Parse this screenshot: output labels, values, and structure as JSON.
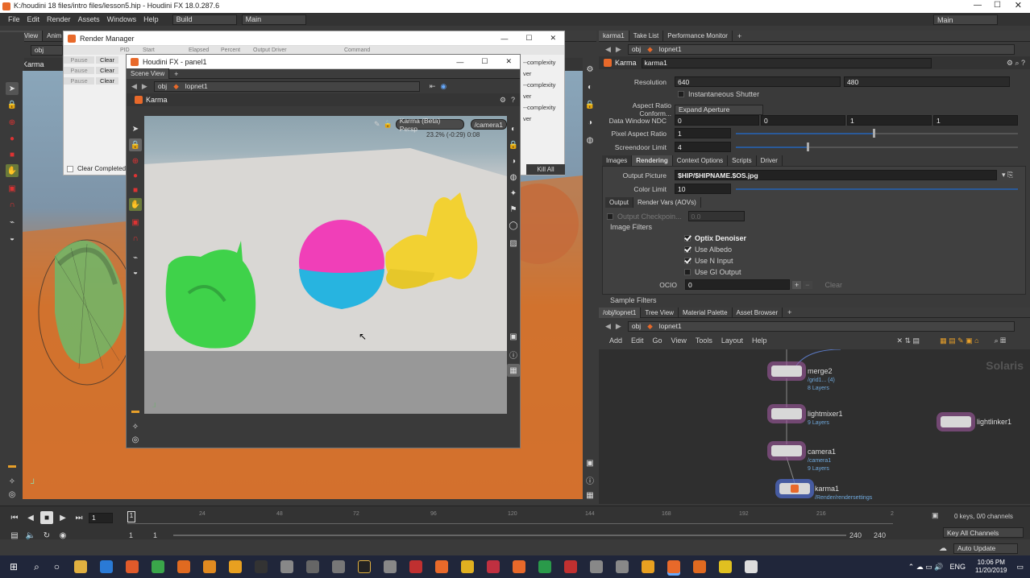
{
  "window": {
    "title": "K:/houdini 18 files/intro files/lesson5.hip - Houdini FX 18.0.287.6"
  },
  "menu": {
    "items": [
      "File",
      "Edit",
      "Render",
      "Assets",
      "Windows",
      "Help"
    ],
    "desktop": "Build",
    "desk_main": "Main",
    "right_main": "Main"
  },
  "left_pane": {
    "tabs": [
      "Scene View",
      "Anim"
    ],
    "path": "obj",
    "renderer": "Karma"
  },
  "render_manager": {
    "title": "Render Manager",
    "columns": [
      "PID",
      "Start",
      "Elapsed",
      "Percent",
      "Output Driver",
      "Command"
    ],
    "rows": [
      {
        "a": "Pause",
        "b": "Clear"
      },
      {
        "a": "Pause",
        "b": "Clear"
      },
      {
        "a": "Pause",
        "b": "Clear"
      }
    ],
    "commands": [
      "--complexity ver",
      "--complexity ver",
      "--complexity ver"
    ],
    "clear_completed": "Clear Completed J",
    "kill_all": "Kill All"
  },
  "float_window": {
    "title": "Houdini FX - panel1",
    "tab": "Scene View",
    "path_obj": "obj",
    "path_lop": "lopnet1",
    "renderer": "Karma",
    "camera_menu": "Karma (Beta) Persp",
    "camera": "/camera1",
    "stats": "23.2%   (-0:29)   0:08"
  },
  "right_pane": {
    "tabs": [
      "karma1",
      "Take List",
      "Performance Monitor"
    ],
    "path_obj": "obj",
    "path_lop": "lopnet1",
    "node_type": "Karma",
    "node_name": "karma1",
    "resolution_label": "Resolution",
    "res_x": "640",
    "res_y": "480",
    "instantaneous_shutter": "Instantaneous Shutter",
    "aspect_label": "Aspect Ratio Conform...",
    "aspect_value": "Expand Aperture",
    "dwndc_label": "Data Window NDC",
    "dwndc": [
      "0",
      "0",
      "1",
      "1"
    ],
    "pixel_aspect_label": "Pixel Aspect Ratio",
    "pixel_aspect": "1",
    "screendoor_label": "Screendoor Limit",
    "screendoor": "4",
    "param_tabs": [
      "Images",
      "Rendering",
      "Context Options",
      "Scripts",
      "Driver"
    ],
    "output_picture_label": "Output Picture",
    "output_picture": "$HIP/$HIPNAME.$OS.jpg",
    "color_limit_label": "Color Limit",
    "color_limit": "10",
    "sub_tabs": [
      "Output",
      "Render Vars (AOVs)"
    ],
    "output_checkpoint": "Output Checkpoin...",
    "output_checkpoint_val": "0.0",
    "image_filters": "Image Filters",
    "filters": [
      {
        "label": "Optix Denoiser",
        "on": true
      },
      {
        "label": "Use Albedo",
        "on": true
      },
      {
        "label": "Use N Input",
        "on": true
      },
      {
        "label": "Use GI Output",
        "on": false
      }
    ],
    "ocio_label": "OCIO",
    "ocio_value": "0",
    "clear": "Clear",
    "sample_filters": "Sample Filters"
  },
  "network": {
    "tabs": [
      "/obj/lopnet1",
      "Tree View",
      "Material Palette",
      "Asset Browser"
    ],
    "path_obj": "obj",
    "path_lop": "lopnet1",
    "menu": [
      "Add",
      "Edit",
      "Go",
      "View",
      "Tools",
      "Layout",
      "Help"
    ],
    "context": "Solaris",
    "nodes": [
      {
        "name": "merge2",
        "sub": "/grid1... (4)",
        "sub2": "8 Layers"
      },
      {
        "name": "lightmixer1",
        "sub": "9 Layers"
      },
      {
        "name": "camera1",
        "sub": "/camera1",
        "sub2": "9 Layers"
      },
      {
        "name": "karma1",
        "sub": "/Render/rendersettings"
      },
      {
        "name": "lightlinker1"
      }
    ]
  },
  "timeline": {
    "frame": "1",
    "ticks": [
      "24",
      "48",
      "72",
      "96",
      "120",
      "144",
      "168",
      "192",
      "216",
      "2"
    ],
    "start": "1",
    "start2": "1",
    "end": "240",
    "end2": "240",
    "keys": "0 keys, 0/0 channels",
    "key_all": "Key All Channels",
    "auto_update": "Auto Update"
  },
  "taskbar": {
    "lang": "ENG",
    "time": "10:06 PM",
    "date": "11/20/2019"
  }
}
